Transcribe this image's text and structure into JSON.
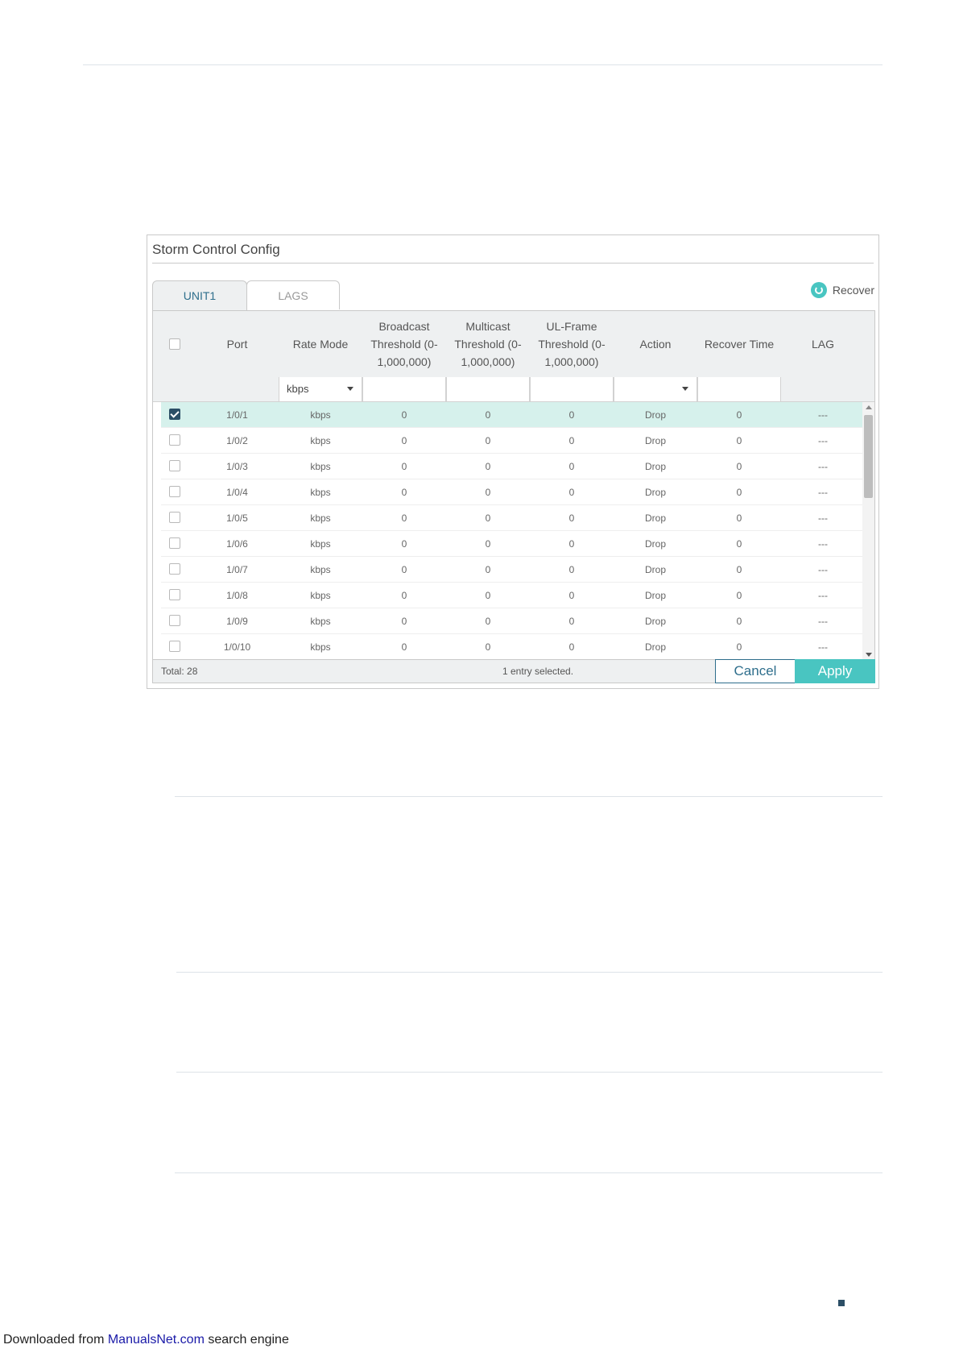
{
  "panel": {
    "title": "Storm Control Config",
    "tabs": [
      {
        "label": "UNIT1",
        "active": true
      },
      {
        "label": "LAGS",
        "active": false
      }
    ],
    "recover_label": "Recover"
  },
  "table": {
    "headers": {
      "port": "Port",
      "rate_mode": "Rate Mode",
      "broadcast_1": "Broadcast",
      "broadcast_2": "Threshold (0-",
      "broadcast_3": "1,000,000)",
      "multicast_1": "Multicast",
      "multicast_2": "Threshold (0-",
      "multicast_3": "1,000,000)",
      "ulframe_1": "UL-Frame",
      "ulframe_2": "Threshold (0-",
      "ulframe_3": "1,000,000)",
      "action": "Action",
      "recover_time": "Recover Time",
      "lag": "LAG"
    },
    "filter": {
      "rate_mode": "kbps",
      "broadcast": "",
      "multicast": "",
      "ulframe": "",
      "action": "",
      "recover_time": ""
    },
    "rows": [
      {
        "checked": true,
        "port": "1/0/1",
        "rate_mode": "kbps",
        "broadcast": "0",
        "multicast": "0",
        "ulframe": "0",
        "action": "Drop",
        "recover_time": "0",
        "lag": "---"
      },
      {
        "checked": false,
        "port": "1/0/2",
        "rate_mode": "kbps",
        "broadcast": "0",
        "multicast": "0",
        "ulframe": "0",
        "action": "Drop",
        "recover_time": "0",
        "lag": "---"
      },
      {
        "checked": false,
        "port": "1/0/3",
        "rate_mode": "kbps",
        "broadcast": "0",
        "multicast": "0",
        "ulframe": "0",
        "action": "Drop",
        "recover_time": "0",
        "lag": "---"
      },
      {
        "checked": false,
        "port": "1/0/4",
        "rate_mode": "kbps",
        "broadcast": "0",
        "multicast": "0",
        "ulframe": "0",
        "action": "Drop",
        "recover_time": "0",
        "lag": "---"
      },
      {
        "checked": false,
        "port": "1/0/5",
        "rate_mode": "kbps",
        "broadcast": "0",
        "multicast": "0",
        "ulframe": "0",
        "action": "Drop",
        "recover_time": "0",
        "lag": "---"
      },
      {
        "checked": false,
        "port": "1/0/6",
        "rate_mode": "kbps",
        "broadcast": "0",
        "multicast": "0",
        "ulframe": "0",
        "action": "Drop",
        "recover_time": "0",
        "lag": "---"
      },
      {
        "checked": false,
        "port": "1/0/7",
        "rate_mode": "kbps",
        "broadcast": "0",
        "multicast": "0",
        "ulframe": "0",
        "action": "Drop",
        "recover_time": "0",
        "lag": "---"
      },
      {
        "checked": false,
        "port": "1/0/8",
        "rate_mode": "kbps",
        "broadcast": "0",
        "multicast": "0",
        "ulframe": "0",
        "action": "Drop",
        "recover_time": "0",
        "lag": "---"
      },
      {
        "checked": false,
        "port": "1/0/9",
        "rate_mode": "kbps",
        "broadcast": "0",
        "multicast": "0",
        "ulframe": "0",
        "action": "Drop",
        "recover_time": "0",
        "lag": "---"
      },
      {
        "checked": false,
        "port": "1/0/10",
        "rate_mode": "kbps",
        "broadcast": "0",
        "multicast": "0",
        "ulframe": "0",
        "action": "Drop",
        "recover_time": "0",
        "lag": "---"
      }
    ]
  },
  "footer": {
    "total": "Total: 28",
    "selected": "1 entry selected.",
    "cancel_label": "Cancel",
    "apply_label": "Apply"
  },
  "page_footer": {
    "prefix": "Downloaded from ",
    "link": "ManualsNet.com",
    "suffix": " search engine"
  },
  "colors": {
    "accent": "#49c5c1",
    "primary": "#2e6e8c",
    "selected_row": "#d6f1ec"
  }
}
